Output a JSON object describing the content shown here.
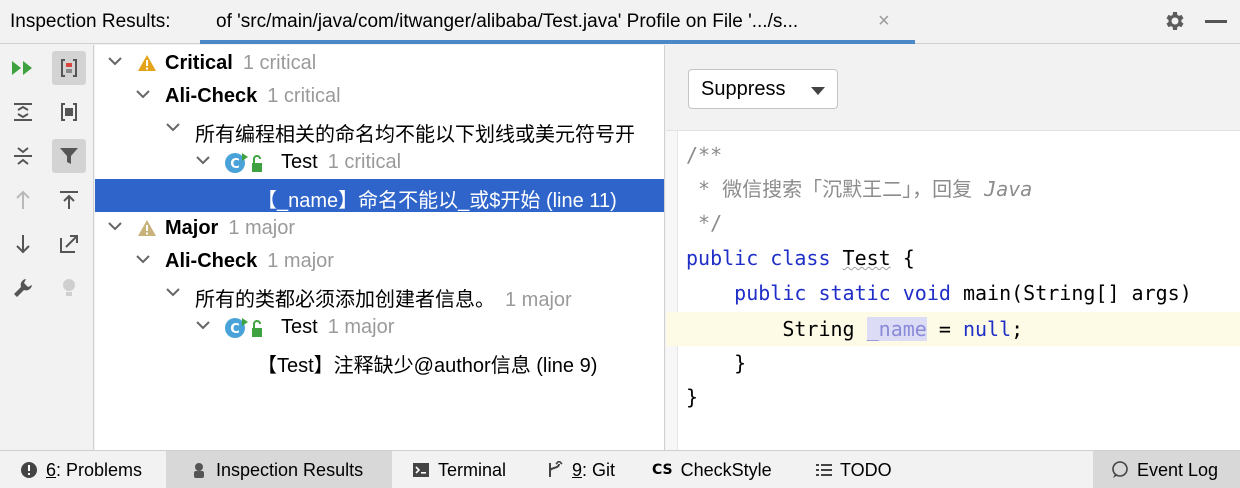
{
  "header": {
    "title": "Inspection Results:",
    "tab_label": "of 'src/main/java/com/itwanger/alibaba/Test.java' Profile on File '.../s...",
    "close": "×"
  },
  "tree": {
    "critical_label": "Critical",
    "critical_count": "1 critical",
    "alicheck1_label": "Ali-Check",
    "alicheck1_count": "1 critical",
    "rule1_label": "所有编程相关的命名均不能以下划线或美元符号开",
    "test1_label": "Test",
    "test1_count": "1 critical",
    "issue1_label": "【_name】命名不能以_或$开始 (line 11)",
    "major_label": "Major",
    "major_count": "1 major",
    "alicheck2_label": "Ali-Check",
    "alicheck2_count": "1 major",
    "rule2_label": "所有的类都必须添加创建者信息。",
    "rule2_count": "1 major",
    "test2_label": "Test",
    "test2_count": "1 major",
    "issue2_label": "【Test】注释缺少@author信息 (line 9)"
  },
  "preview": {
    "suppress_label": "Suppress",
    "code": {
      "l1": "/**",
      "l2a": " * 微信搜索「沉默王二」，回复 ",
      "l2b": "Java",
      "l3": " */",
      "l4_kw": "public class ",
      "l4_name": "Test",
      "l4_rest": " {",
      "l5_indent": "    ",
      "l5_kw": "public static void ",
      "l5_rest": "main(String[] args)",
      "l6_a": "        String ",
      "l6_name": "_name",
      "l6_b": " = ",
      "l6_null": "null",
      "l6_c": ";",
      "l7": "    }",
      "l8": "}"
    }
  },
  "bottombar": {
    "problems_num": "6",
    "problems_label": ": Problems",
    "inspection_label": "Inspection Results",
    "terminal_label": "Terminal",
    "git_num": "9",
    "git_label": ": Git",
    "checkstyle_label": "CheckStyle",
    "todo_label": "TODO",
    "eventlog_label": "Event Log"
  },
  "colors": {
    "selection": "#2f65ca",
    "tab_underline": "#4a88c7",
    "keyword": "#1f2ec6",
    "warning_critical": "#e3a41b",
    "warning_major": "#c9b27a"
  }
}
